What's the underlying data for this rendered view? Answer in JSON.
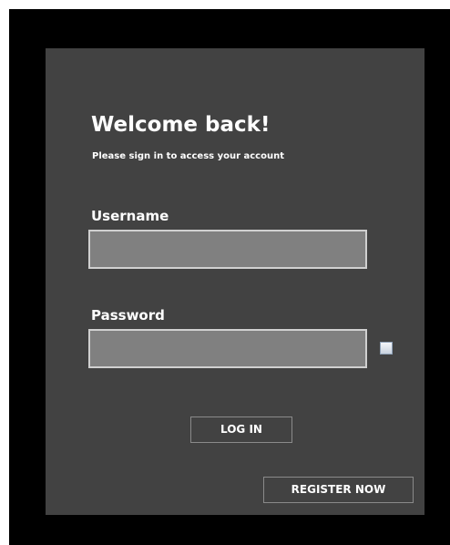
{
  "header": {
    "title": "Welcome back!",
    "subtitle": "Please sign in to access your account"
  },
  "form": {
    "username_label": "Username",
    "username_value": "",
    "password_label": "Password",
    "password_value": "",
    "show_password_checked": false
  },
  "actions": {
    "login_label": "LOG IN",
    "register_label": "REGISTER NOW"
  },
  "colors": {
    "frame": "#000000",
    "panel": "#424242",
    "input_fill": "#808080",
    "text": "#ffffff"
  }
}
